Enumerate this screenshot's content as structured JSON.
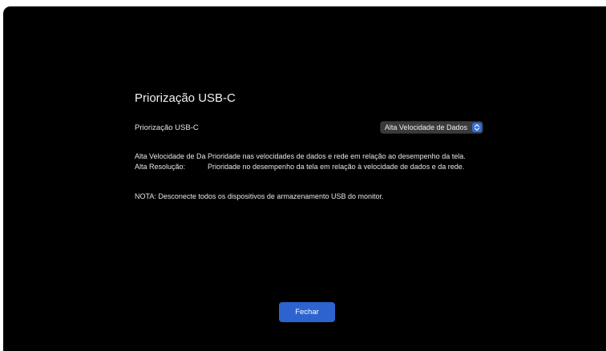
{
  "dialog": {
    "title": "Priorização USB-C",
    "setting": {
      "label": "Priorização USB-C",
      "selected_value": "Alta Velocidade de Dados"
    },
    "descriptions": [
      {
        "key": "Alta Velocidade de Dados:",
        "value": "Prioridade nas velocidades de dados e rede em relação ao desempenho da tela."
      },
      {
        "key": "Alta Resolução:",
        "value": "Prioridade no desempenho da tela em relação à velocidade de dados e da rede."
      }
    ],
    "note": "NOTA: Desconecte todos os dispositivos de armazenamento USB do monitor.",
    "close_label": "Fechar"
  },
  "colors": {
    "window_background": "#000000",
    "accent": "#2c63cf",
    "popup_background": "#3a3a3c"
  },
  "icons": {
    "popup_arrows": "chevron-up-down-icon"
  }
}
